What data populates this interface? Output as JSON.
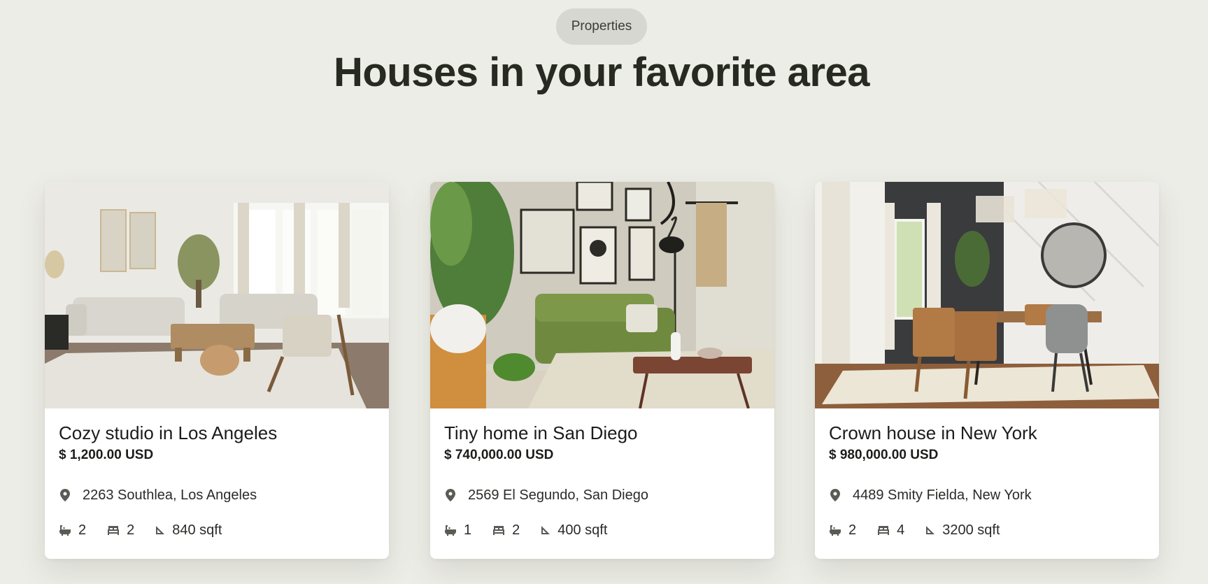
{
  "section": {
    "badge": "Properties",
    "heading": "Houses in your favorite area"
  },
  "listings": [
    {
      "title": "Cozy studio in Los Angeles",
      "price": "$ 1,200.00 USD",
      "address": "2263 Southlea, Los Angeles",
      "bathrooms": "2",
      "bedrooms": "2",
      "area": "840 sqft"
    },
    {
      "title": "Tiny home in San Diego",
      "price": "$ 740,000.00 USD",
      "address": "2569 El Segundo, San Diego",
      "bathrooms": "1",
      "bedrooms": "2",
      "area": "400 sqft"
    },
    {
      "title": "Crown house in New York",
      "price": "$ 980,000.00 USD",
      "address": "4489 Smity Fielda, New York",
      "bathrooms": "2",
      "bedrooms": "4",
      "area": "3200 sqft"
    }
  ],
  "icons": {
    "location": "map-pin-icon",
    "bathrooms": "bathtub-icon",
    "bedrooms": "bed-icon",
    "area": "ruler-triangle-icon"
  },
  "colors": {
    "background": "#edede7",
    "badge_background": "#d6d7d1",
    "heading": "#272a20",
    "card": "#ffffff",
    "icon": "#5a5b55"
  }
}
